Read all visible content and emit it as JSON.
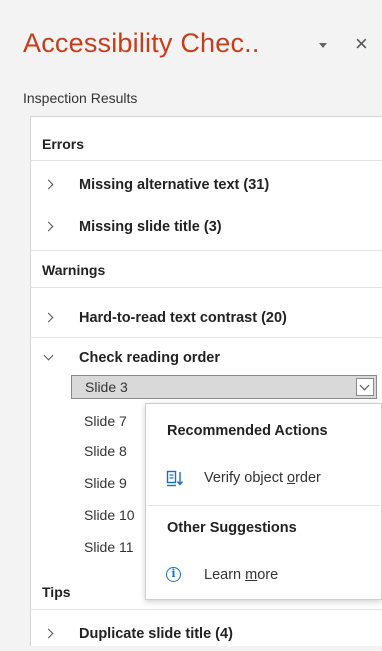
{
  "pane": {
    "title": "Accessibility Chec..",
    "subtitle": "Inspection Results"
  },
  "sections": {
    "errors": "Errors",
    "warnings": "Warnings",
    "tips": "Tips"
  },
  "errors": [
    {
      "label": "Missing alternative text (31)",
      "expanded": false
    },
    {
      "label": "Missing slide title (3)",
      "expanded": false
    }
  ],
  "warnings": [
    {
      "label": "Hard-to-read text contrast (20)",
      "expanded": false
    },
    {
      "label": "Check reading order",
      "expanded": true
    }
  ],
  "reading_order": {
    "selected": "Slide 3",
    "slides": [
      "Slide 7",
      "Slide 8",
      "Slide 9",
      "Slide 10",
      "Slide 11"
    ]
  },
  "tips": [
    {
      "label": "Duplicate slide title (4)",
      "expanded": false
    }
  ],
  "context_menu": {
    "recommended_header": "Recommended Actions",
    "verify_prefix": "Verify object ",
    "verify_underlined": "o",
    "verify_suffix": "rder",
    "other_header": "Other Suggestions",
    "learn_prefix": "Learn ",
    "learn_underlined": "m",
    "learn_suffix": "ore"
  },
  "icons": {
    "pane_menu": "chevron-down-icon",
    "close": "close-icon",
    "verify": "reorder-objects-icon",
    "learn": "info-icon"
  },
  "colors": {
    "title": "#c43e1c",
    "accent": "#1b6ec2",
    "selected_slide_bg": "#d9d9d9"
  }
}
